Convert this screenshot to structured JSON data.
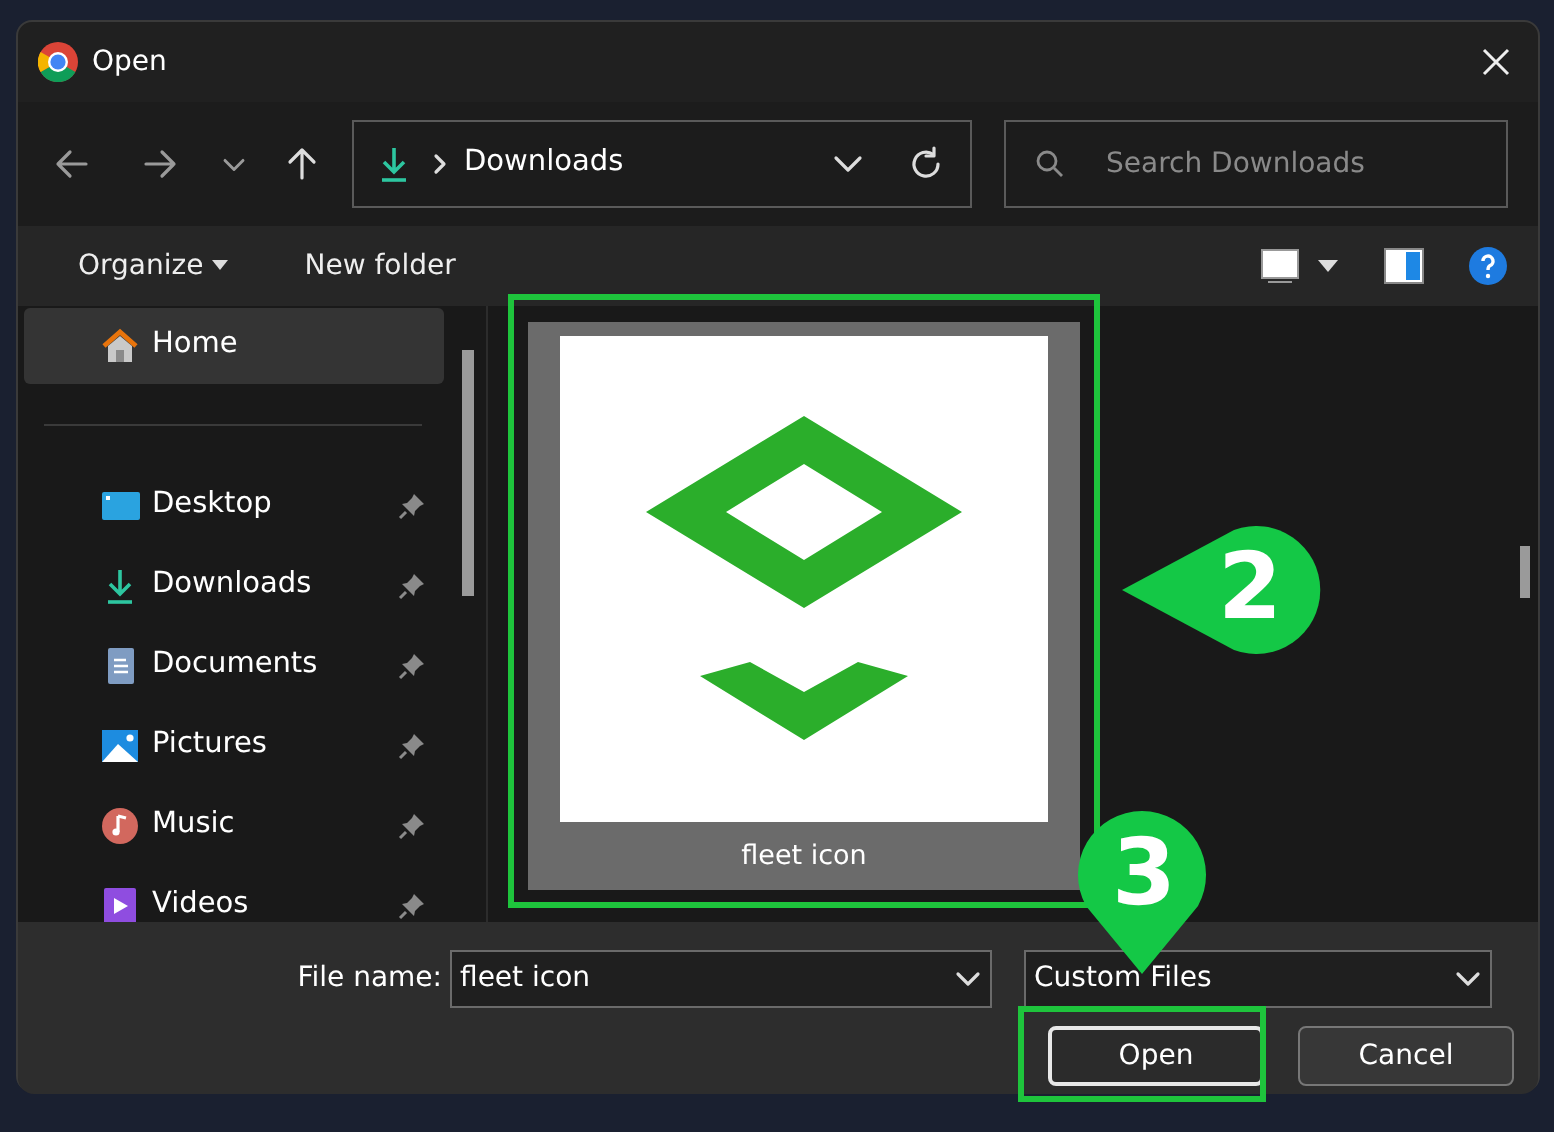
{
  "window": {
    "title": "Open"
  },
  "nav": {
    "path": "Downloads",
    "search": {
      "placeholder": "Search Downloads"
    }
  },
  "toolbar": {
    "organize": "Organize",
    "new_folder": "New folder"
  },
  "sidebar": {
    "items": [
      {
        "label": "Home",
        "kind": "home",
        "selected": true,
        "pinned": false
      },
      {
        "label": "Desktop",
        "kind": "desktop",
        "selected": false,
        "pinned": true
      },
      {
        "label": "Downloads",
        "kind": "downloads",
        "selected": false,
        "pinned": true
      },
      {
        "label": "Documents",
        "kind": "documents",
        "selected": false,
        "pinned": true
      },
      {
        "label": "Pictures",
        "kind": "pictures",
        "selected": false,
        "pinned": true
      },
      {
        "label": "Music",
        "kind": "music",
        "selected": false,
        "pinned": true
      },
      {
        "label": "Videos",
        "kind": "videos",
        "selected": false,
        "pinned": true
      }
    ]
  },
  "files": [
    {
      "name": "fleet icon",
      "selected": true
    }
  ],
  "footer": {
    "file_name_label": "File name:",
    "file_name": "fleet icon",
    "file_type": "Custom Files",
    "buttons": [
      {
        "label": "Open",
        "kind": "primary"
      },
      {
        "label": "Cancel",
        "kind": "secondary"
      }
    ]
  },
  "annotations": [
    {
      "label": "2"
    },
    {
      "label": "3"
    }
  ]
}
